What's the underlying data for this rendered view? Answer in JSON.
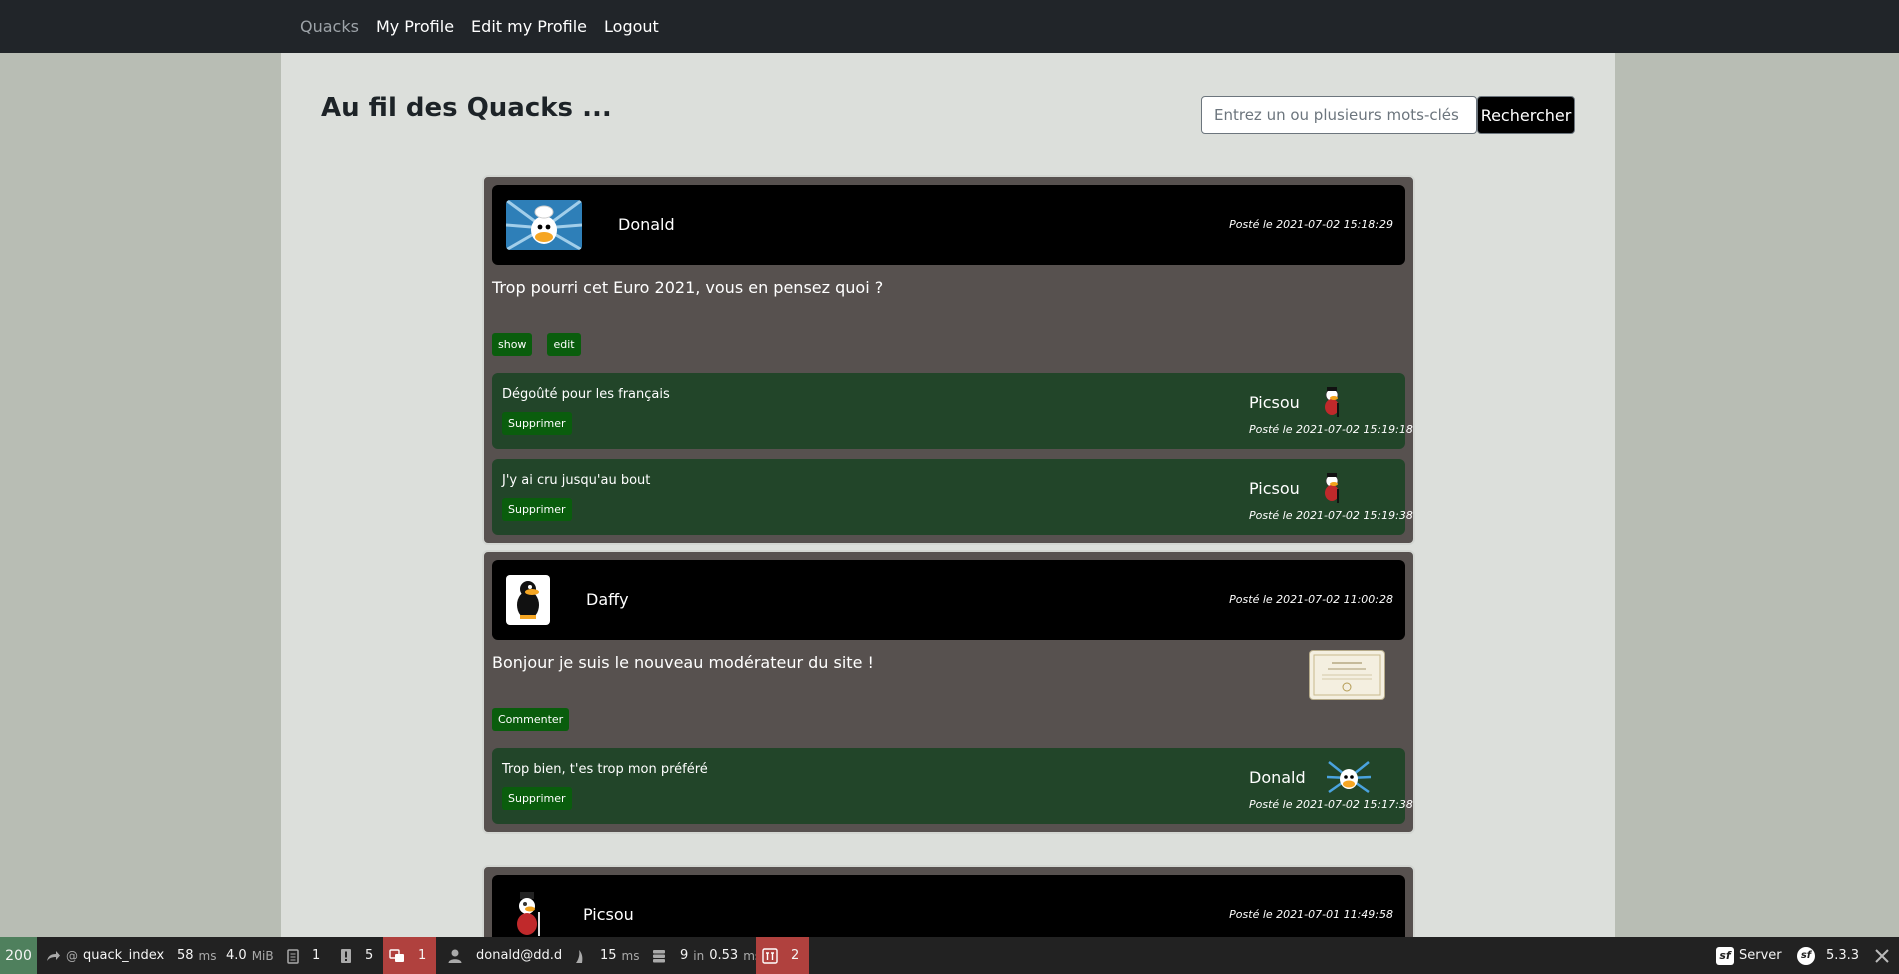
{
  "nav": {
    "brand": "Quacks",
    "links": [
      "My Profile",
      "Edit my Profile",
      "Logout"
    ]
  },
  "page": {
    "title": "Au fil des Quacks ..."
  },
  "search": {
    "placeholder": "Entrez un ou plusieurs mots-clés",
    "button_label": "Rechercher"
  },
  "quacks": [
    {
      "author": "Donald",
      "posted": "Posté le 2021-07-02 15:18:29",
      "text": "Trop pourri cet Euro 2021, vous en pensez quoi ?",
      "actions": [
        "show",
        "edit"
      ],
      "comments": [
        {
          "text": "Dégoûté pour les français",
          "author": "Picsou",
          "date": "Posté le 2021-07-02 15:19:18",
          "delete_label": "Supprimer"
        },
        {
          "text": "J'y ai cru jusqu'au bout",
          "author": "Picsou",
          "date": "Posté le 2021-07-02 15:19:38",
          "delete_label": "Supprimer"
        }
      ]
    },
    {
      "author": "Daffy",
      "posted": "Posté le 2021-07-02 11:00:28",
      "text": "Bonjour je suis le nouveau modérateur du site !",
      "actions": [
        "Commenter"
      ],
      "comments": [
        {
          "text": "Trop bien, t'es trop mon préféré",
          "author": "Donald",
          "date": "Posté le 2021-07-02 15:17:38",
          "delete_label": "Supprimer"
        }
      ]
    },
    {
      "author": "Picsou",
      "posted": "Posté le 2021-07-01 11:49:58"
    }
  ],
  "toolbar": {
    "status": "200",
    "route_prefix": "@",
    "route": "quack_index",
    "time": "58",
    "time_unit": "ms",
    "memory": "4.0",
    "memory_unit": "MiB",
    "logs": "1",
    "warnings": "5",
    "messages": "1",
    "user": "donald@dd.d",
    "twig_time": "15",
    "twig_unit": "ms",
    "db_queries": "9",
    "db_in": "in",
    "db_time": "0.53",
    "db_unit": "ms",
    "validation": "2",
    "server": "Server",
    "version": "5.3.3"
  }
}
